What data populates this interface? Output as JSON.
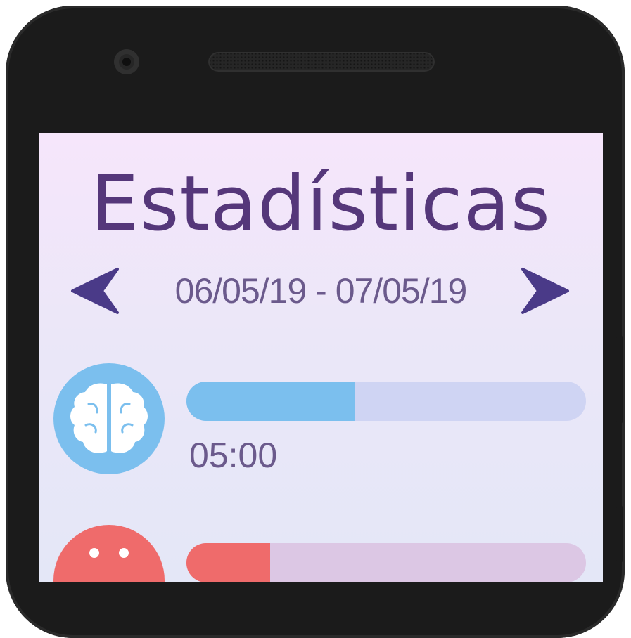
{
  "screen": {
    "title": "Estadísticas",
    "date_range": "06/05/19 - 07/05/19",
    "nav": {
      "prev_icon": "chevron-left-icon",
      "next_icon": "chevron-right-icon"
    }
  },
  "stats": [
    {
      "icon": "brain-icon",
      "time": "05:00",
      "progress": 0.42,
      "color": "#7bbfee",
      "track_color": "#cfd4f3"
    },
    {
      "icon": "face-icon",
      "time": "",
      "progress": 0.21,
      "color": "#ef6b6b",
      "track_color": "#dcc7e4"
    }
  ],
  "colors": {
    "title": "#55377a",
    "text": "#6b5a8c",
    "arrow": "#4a3a88"
  }
}
